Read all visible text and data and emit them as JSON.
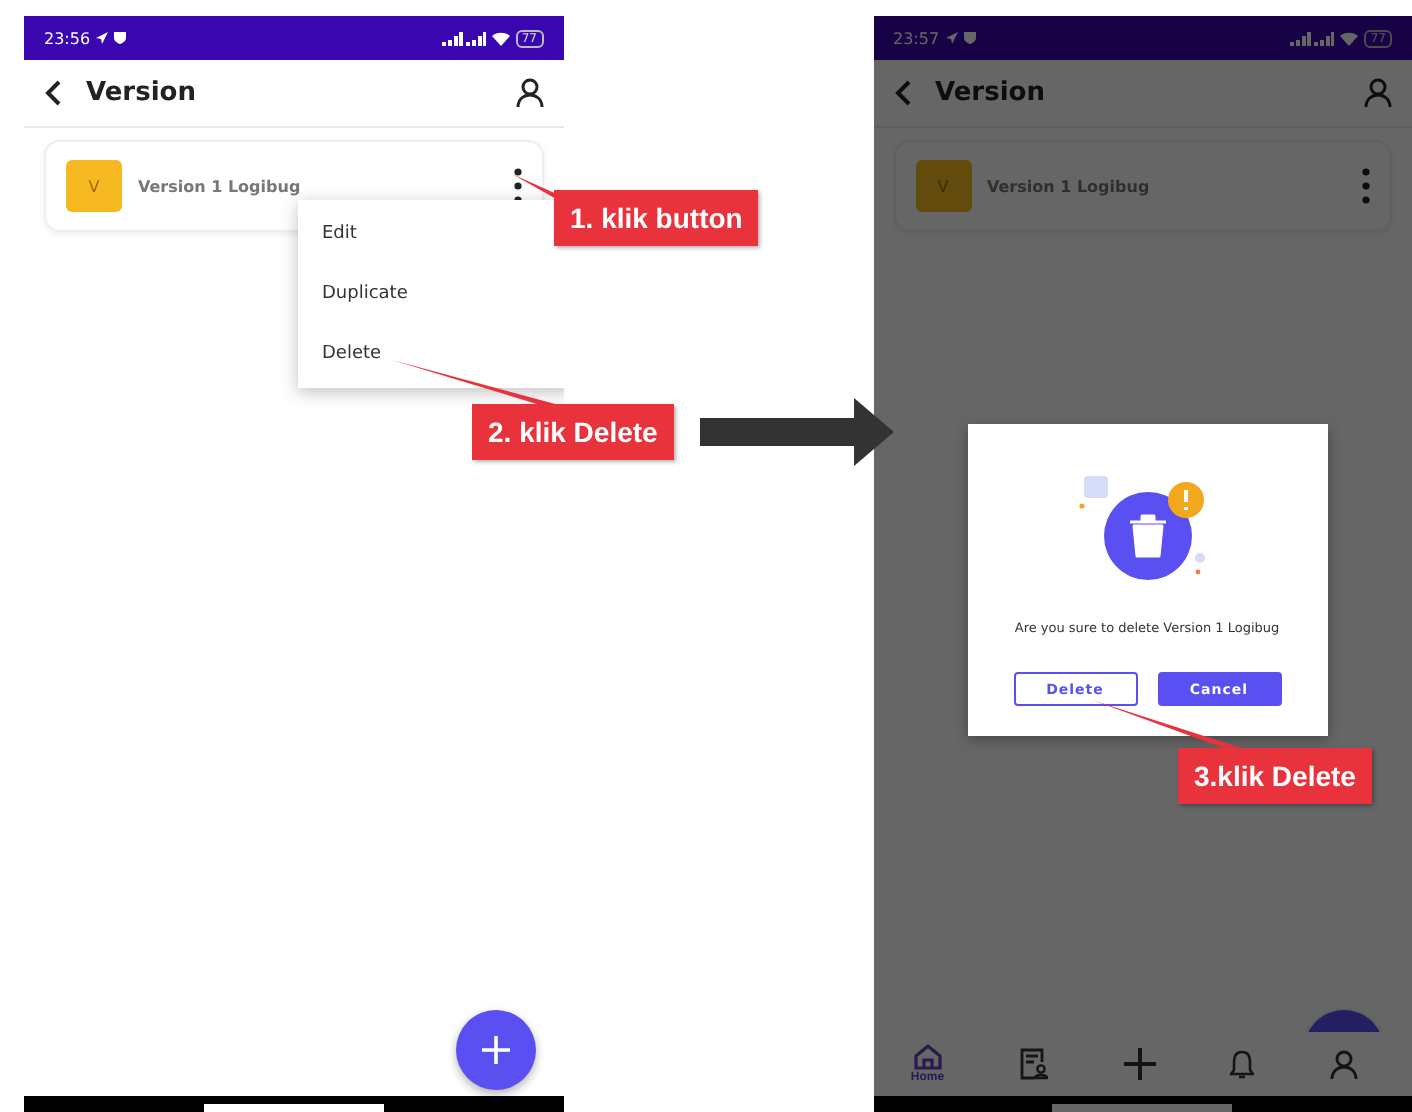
{
  "screens": [
    {
      "status_time": "23:56",
      "battery": "77",
      "title": "Version",
      "dimmed": false,
      "items": [
        {
          "badge": "V",
          "name": "Version 1 Logibug"
        }
      ],
      "menu": [
        {
          "label": "Edit"
        },
        {
          "label": "Duplicate"
        },
        {
          "label": "Delete"
        }
      ]
    },
    {
      "status_time": "23:57",
      "battery": "77",
      "title": "Version",
      "dimmed": true,
      "items": [
        {
          "badge": "V",
          "name": "Version 1 Logibug"
        }
      ],
      "dialog": {
        "message": "Are you sure to delete Version 1 Logibug",
        "buttons": [
          {
            "label": "Delete",
            "kind": "outline"
          },
          {
            "label": "Cancel",
            "kind": "filled"
          }
        ]
      },
      "nav": [
        {
          "kind": "home",
          "label": "Home",
          "selected": true
        },
        {
          "kind": "document",
          "selected": false
        },
        {
          "kind": "add",
          "selected": false
        },
        {
          "kind": "bell",
          "selected": false
        },
        {
          "kind": "person",
          "selected": false
        }
      ]
    }
  ],
  "annotations": [
    {
      "text": "1. klik button"
    },
    {
      "text": "2. klik Delete"
    },
    {
      "text": "3.klik Delete"
    }
  ]
}
